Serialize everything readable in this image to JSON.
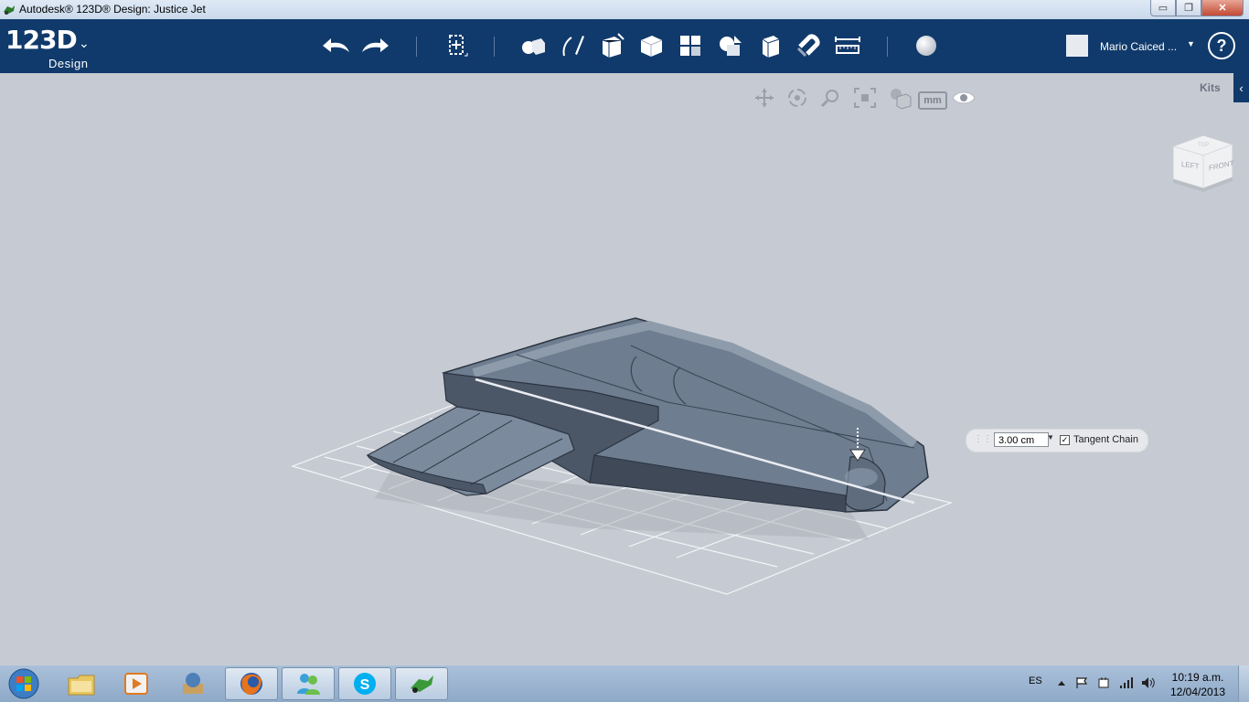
{
  "window": {
    "title": "Autodesk® 123D® Design: Justice Jet",
    "minimize": "▭",
    "maximize": "❐",
    "close": "✕"
  },
  "app": {
    "logo_text": "123D",
    "logo_sub": "Design",
    "logo_menu": "⌄"
  },
  "toolbar": {
    "tools": [
      "undo-icon",
      "redo-icon",
      "transform-icon",
      "primitives-icon",
      "sketch-icon",
      "construct-icon",
      "modify-icon",
      "pattern-icon",
      "group-icon",
      "combine-icon",
      "snap-icon",
      "measure-icon",
      "material-icon"
    ]
  },
  "user": {
    "name": "Mario Caiced ...",
    "dropdown": "▼"
  },
  "help": {
    "label": "?"
  },
  "navbar": {
    "units_label": "mm"
  },
  "kits": {
    "label": "Kits",
    "toggle": "‹"
  },
  "viewcube": {
    "left": "LEFT",
    "front": "FRONT",
    "top": "TOP"
  },
  "fillet": {
    "value": "3.00 cm",
    "tangent_chain_label": "Tangent Chain",
    "tangent_chain_checked": "✓",
    "dropdown": "▼"
  },
  "taskbar": {
    "apps": [
      "windows-explorer-icon",
      "media-player-icon",
      "app-icon",
      "firefox-icon",
      "messenger-icon",
      "skype-icon",
      "123d-design-icon"
    ],
    "language": "ES",
    "time": "10:19 a.m.",
    "date": "12/04/2013"
  },
  "colors": {
    "toolbar": "#103a6b",
    "viewport": "#c6cbd3",
    "model": "#6b7a8d",
    "accent": "#ffffff"
  }
}
